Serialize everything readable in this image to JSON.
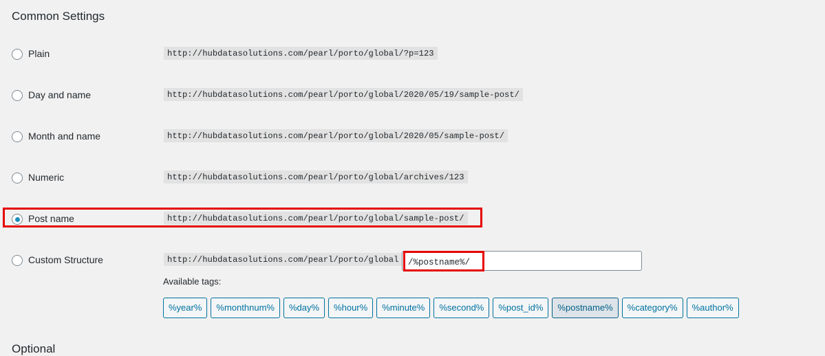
{
  "section_title": "Common Settings",
  "options": [
    {
      "label": "Plain",
      "example": "http://hubdatasolutions.com/pearl/porto/global/?p=123",
      "checked": false
    },
    {
      "label": "Day and name",
      "example": "http://hubdatasolutions.com/pearl/porto/global/2020/05/19/sample-post/",
      "checked": false
    },
    {
      "label": "Month and name",
      "example": "http://hubdatasolutions.com/pearl/porto/global/2020/05/sample-post/",
      "checked": false
    },
    {
      "label": "Numeric",
      "example": "http://hubdatasolutions.com/pearl/porto/global/archives/123",
      "checked": false
    },
    {
      "label": "Post name",
      "example": "http://hubdatasolutions.com/pearl/porto/global/sample-post/",
      "checked": true
    },
    {
      "label": "Custom Structure",
      "example": "http://hubdatasolutions.com/pearl/porto/global",
      "checked": false
    }
  ],
  "custom_structure_value": "/%postname%/",
  "available_tags_label": "Available tags:",
  "tags": [
    "%year%",
    "%monthnum%",
    "%day%",
    "%hour%",
    "%minute%",
    "%second%",
    "%post_id%",
    "%postname%",
    "%category%",
    "%author%"
  ],
  "active_tag": "%postname%",
  "next_section_title": "Optional",
  "colors": {
    "background": "#f1f1f1",
    "accent": "#0071a1",
    "radio_checked": "#1e8cbe",
    "highlight": "#e60000"
  }
}
